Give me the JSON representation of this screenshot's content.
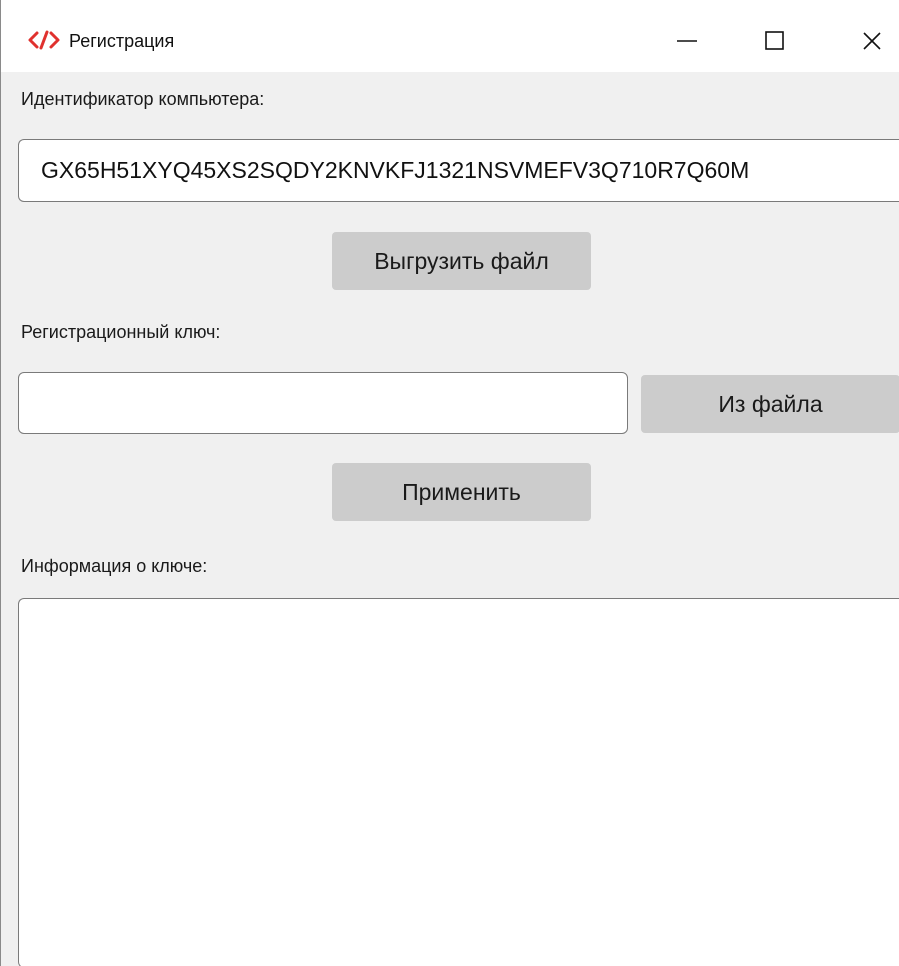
{
  "window": {
    "title": "Регистрация",
    "app_icon": "code-brackets-icon",
    "accent_color": "#e0312e",
    "controls": {
      "minimize": "minimize-icon",
      "maximize": "maximize-icon",
      "close": "close-icon"
    }
  },
  "computer_id": {
    "label": "Идентификатор компьютера:",
    "value": "GX65H51XYQ45XS2SQDY2KNVKFJ1321NSVMEFV3Q710R7Q60M"
  },
  "export_button": "Выгрузить файл",
  "registration_key": {
    "label": "Регистрационный ключ:",
    "value": "",
    "from_file_button": "Из файла"
  },
  "apply_button": "Применить",
  "key_info": {
    "label": "Информация о ключе:",
    "value": ""
  }
}
